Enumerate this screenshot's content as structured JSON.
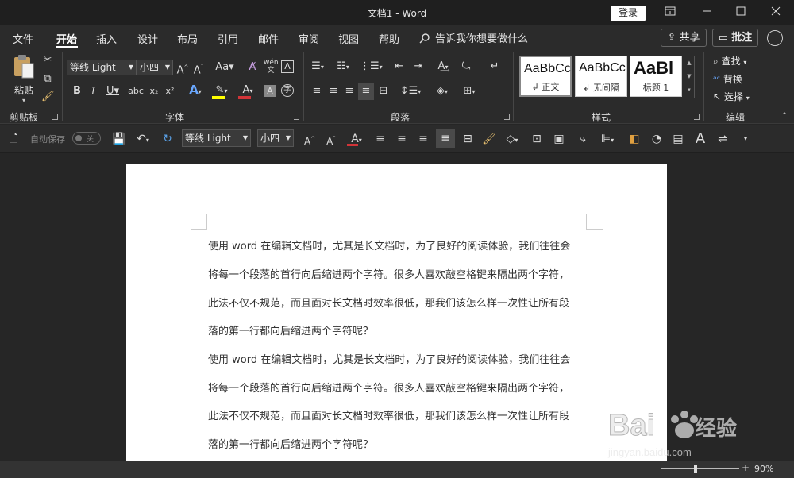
{
  "window": {
    "title": "文档1  -  Word",
    "login_label": "登录",
    "controls": [
      "restore-ribbon",
      "minimize",
      "maximize",
      "close"
    ]
  },
  "tabs": [
    "文件",
    "开始",
    "插入",
    "设计",
    "布局",
    "引用",
    "邮件",
    "审阅",
    "视图",
    "帮助"
  ],
  "active_tab": "开始",
  "tell_me": "告诉我你想要做什么",
  "share_label": "共享",
  "comments_label": "批注",
  "ribbon": {
    "clipboard": {
      "label": "剪贴板",
      "paste_label": "粘贴"
    },
    "font": {
      "label": "字体",
      "font_name": "等线 Light",
      "font_size": "小四",
      "bold": "B",
      "italic": "I",
      "underline": "U",
      "strike": "abc",
      "subscript": "x₂",
      "superscript": "x²",
      "grow": "A^",
      "shrink": "Aˇ",
      "change_case": "Aa",
      "phonetic": "wén"
    },
    "paragraph": {
      "label": "段落"
    },
    "styles": {
      "label": "样式",
      "items": [
        {
          "preview": "AaBbCcDd",
          "name": "↲ 正文"
        },
        {
          "preview": "AaBbCcDd",
          "name": "↲ 无间隔"
        },
        {
          "preview": "AaBl",
          "name": "标题 1"
        }
      ]
    },
    "editing": {
      "label": "编辑",
      "find": "查找",
      "replace": "替换",
      "select": "选择"
    }
  },
  "qat": {
    "autosave_label": "自动保存",
    "autosave_state": "关",
    "font_name": "等线 Light",
    "font_size": "小四"
  },
  "document": {
    "lines": [
      "使用 word 在编辑文档时，尤其是长文档时，为了良好的阅读体验，我们往往会",
      "将每一个段落的首行向后缩进两个字符。很多人喜欢敲空格键来隔出两个字符，",
      "此法不仅不规范，而且面对长文档时效率很低，那我们该怎么样一次性让所有段",
      "落的第一行都向后缩进两个字符呢？",
      "使用 word 在编辑文档时，尤其是长文档时，为了良好的阅读体验，我们往往会",
      "将每一个段落的首行向后缩进两个字符。很多人喜欢敲空格键来隔出两个字符，",
      "此法不仅不规范，而且面对长文档时效率很低，那我们该怎么样一次性让所有段",
      "落的第一行都向后缩进两个字符呢？"
    ]
  },
  "statusbar": {
    "zoom": "90%"
  },
  "colors": {
    "font_color": "#d13438",
    "highlight": "#ffff00",
    "accent_purple": "#c239b3",
    "accent_blue": "#5aa0e6"
  }
}
